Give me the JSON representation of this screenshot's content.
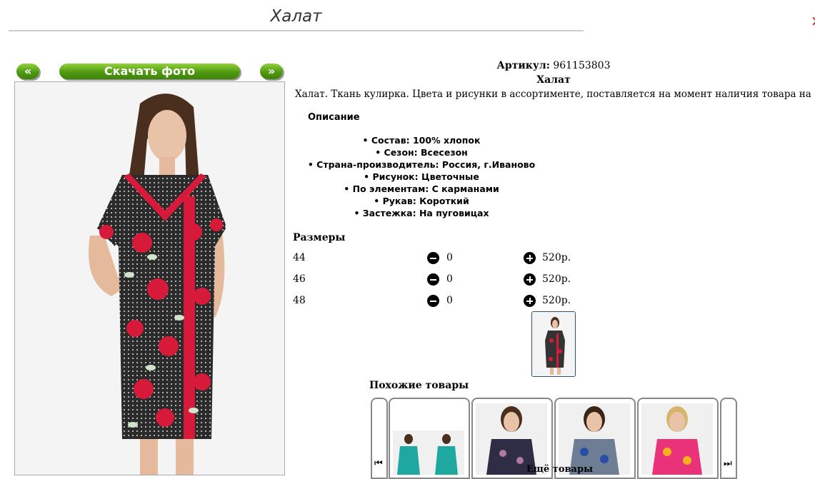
{
  "page": {
    "title": "Халат",
    "corner_mark": "✕"
  },
  "nav": {
    "prev_label": "«",
    "download_label": "Скачать фото",
    "next_label": "»"
  },
  "product": {
    "article_label": "Артикул:",
    "article_value": "961153803",
    "name": "Халат",
    "description": "Халат. Ткань кулирка. Цвета и рисунки в ассортименте, поставляется на момент наличия товара на складе",
    "props_heading": "Описание",
    "props": [
      "Состав: 100% хлопок",
      "Сезон: Всесезон",
      "Страна-производитель: Россия, г.Иваново",
      "Рисунок: Цветочные",
      "По элементам: С карманами",
      "Рукав: Короткий",
      "Застежка: На пуговицах"
    ]
  },
  "sizes": {
    "heading": "Размеры",
    "rows": [
      {
        "size": "44",
        "qty": "0",
        "price": "520р."
      },
      {
        "size": "46",
        "qty": "0",
        "price": "520р."
      },
      {
        "size": "48",
        "qty": "0",
        "price": "520р."
      }
    ]
  },
  "similar": {
    "heading": "Похожие товары",
    "prev_icon": "skip-back-icon",
    "next_icon": "skip-forward-icon",
    "more_label": "Ещё товары"
  },
  "colors": {
    "green_button": "#5aa316",
    "dress_accent": "#d7193a",
    "thumb_border": "#2f4f6f"
  }
}
